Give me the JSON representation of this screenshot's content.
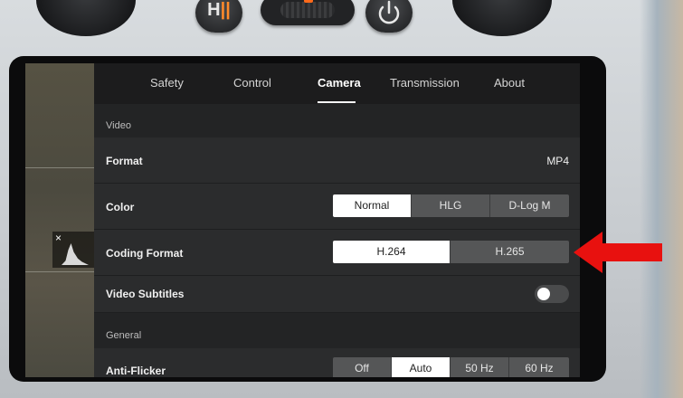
{
  "hardware": {
    "pause_button_glyph_left": "H",
    "pause_button_glyph_right": "||",
    "power_icon": "power-icon"
  },
  "tabs": [
    {
      "label": "Safety",
      "active": false
    },
    {
      "label": "Control",
      "active": false
    },
    {
      "label": "Camera",
      "active": true
    },
    {
      "label": "Transmission",
      "active": false
    },
    {
      "label": "About",
      "active": false
    }
  ],
  "video_section": {
    "title": "Video",
    "format": {
      "label": "Format",
      "value": "MP4"
    },
    "color": {
      "label": "Color",
      "options": [
        "Normal",
        "HLG",
        "D-Log M"
      ],
      "selected": "Normal"
    },
    "coding_format": {
      "label": "Coding Format",
      "options": [
        "H.264",
        "H.265"
      ],
      "selected": "H.264"
    },
    "video_subtitles": {
      "label": "Video Subtitles",
      "enabled": false
    }
  },
  "general_section": {
    "title": "General",
    "anti_flicker": {
      "label": "Anti-Flicker",
      "options": [
        "Off",
        "Auto",
        "50 Hz",
        "60 Hz"
      ],
      "selected": "Auto"
    }
  },
  "histogram": {
    "close_glyph": "×"
  },
  "colors": {
    "accent_arrow": "#e8110f",
    "panel_bg": "#232425",
    "selected_option_bg": "#ffffff"
  }
}
